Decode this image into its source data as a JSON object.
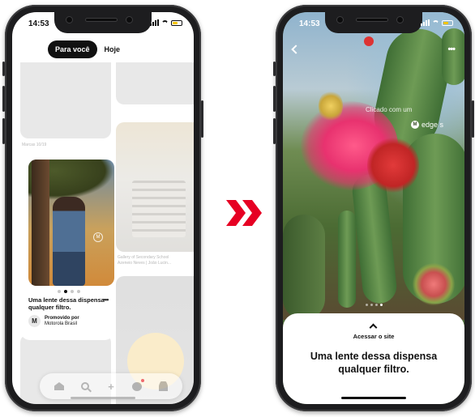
{
  "left_phone": {
    "status": {
      "time": "14:53"
    },
    "tabs": {
      "active": "Para você",
      "inactive": "Hoje"
    },
    "captions": {
      "tile1": "Marcas 10/19",
      "tile2_line1": "Gallery of Secondary School",
      "tile2_line2": "Azeneio Neves | João Lucin..."
    },
    "pin": {
      "title": "Uma lente dessa dispensa qualquer filtro.",
      "more": "•••",
      "promoted_label": "Promovido por",
      "advertiser": "Motorola Brasil",
      "carousel_dots": 4,
      "active_dot": 2
    },
    "nav": {
      "items": [
        "home-icon",
        "search-icon",
        "add-icon",
        "chat-icon",
        "profile-icon"
      ]
    }
  },
  "right_phone": {
    "status": {
      "time": "14:53"
    },
    "more": "•••",
    "watermark": {
      "line1": "Clicado com um",
      "brand": "edge s"
    },
    "sheet": {
      "visit_site": "Acessar o site",
      "title": "Uma lente dessa dispensa qualquer filtro."
    },
    "carousel_dots": 4,
    "active_dot": 4
  },
  "colors": {
    "accent_red": "#e60023",
    "tab_active_bg": "#111111"
  }
}
